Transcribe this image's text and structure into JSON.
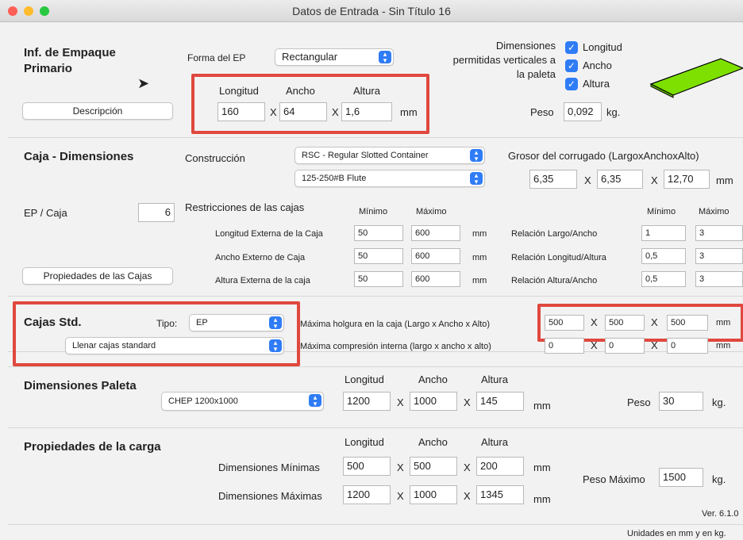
{
  "window": {
    "title": "Datos de Entrada - Sin Título 16"
  },
  "icons": {
    "close": "#fe5f57",
    "minimize": "#febc2e",
    "zoom": "#28c840",
    "accent": "#2f7cf6",
    "highlight": "#e0483e",
    "package": "#7ee000"
  },
  "s1": {
    "title_l1": "Inf. de Empaque",
    "title_l2": "Primario",
    "forma_label": "Forma del EP",
    "forma_value": "Rectangular",
    "descripcion": "Descripción",
    "hdr_longitud": "Longitud",
    "hdr_ancho": "Ancho",
    "hdr_altura": "Altura",
    "longitud": "160",
    "ancho": "64",
    "altura": "1,6",
    "x": "X",
    "mm": "mm",
    "dim_l1": "Dimensiones",
    "dim_l2": "permitidas verticales a",
    "dim_l3": "la paleta",
    "chk_longitud": "Longitud",
    "chk_ancho": "Ancho",
    "chk_altura": "Altura",
    "peso_label": "Peso",
    "peso": "0,092",
    "kg": "kg."
  },
  "s2": {
    "title": "Caja - Dimensiones",
    "construccion_label": "Construcción",
    "construccion": "RSC - Regular Slotted Container",
    "flute": "125-250#B Flute",
    "grosor_label": "Grosor del corrugado (LargoxAnchoxAlto)",
    "g1": "6,35",
    "g2": "6,35",
    "g3": "12,70",
    "x": "X",
    "mm": "mm",
    "ep_caja_label": "EP / Caja",
    "ep_caja": "6",
    "restricciones": "Restricciones de las cajas",
    "minimo": "Mínimo",
    "maximo": "Máximo",
    "rows": [
      {
        "label": "Longitud Externa de la Caja",
        "min": "50",
        "max": "600",
        "unit": "mm",
        "rlabel": "Relación Largo/Ancho",
        "rmin": "1",
        "rmax": "3"
      },
      {
        "label": "Ancho Externo de Caja",
        "min": "50",
        "max": "600",
        "unit": "mm",
        "rlabel": "Relación Longitud/Altura",
        "rmin": "0,5",
        "rmax": "3"
      },
      {
        "label": "Altura Externa de la caja",
        "min": "50",
        "max": "600",
        "unit": "mm",
        "rlabel": "Relación Altura/Ancho",
        "rmin": "0,5",
        "rmax": "3"
      }
    ],
    "propiedades": "Propiedades de las Cajas"
  },
  "s3": {
    "title": "Cajas Std.",
    "tipo_label": "Tipo:",
    "tipo": "EP",
    "llenar": "Llenar cajas standard",
    "holgura_label": "Máxima holgura en la caja (Largo x Ancho x Alto)",
    "h1": "500",
    "h2": "500",
    "h3": "500",
    "compresion_label": "Máxima compresión interna (largo x ancho x alto)",
    "c1": "0",
    "c2": "0",
    "c3": "0",
    "x": "X",
    "mm": "mm"
  },
  "s4": {
    "title": "Dimensiones Paleta",
    "paleta": "CHEP 1200x1000",
    "hdr_longitud": "Longitud",
    "hdr_ancho": "Ancho",
    "hdr_altura": "Altura",
    "longitud": "1200",
    "ancho": "1000",
    "altura": "145",
    "x": "X",
    "mm": "mm",
    "peso_label": "Peso",
    "peso": "30",
    "kg": "kg."
  },
  "s5": {
    "title": "Propiedades de la carga",
    "hdr_longitud": "Longitud",
    "hdr_ancho": "Ancho",
    "hdr_altura": "Altura",
    "min_label": "Dimensiones Mínimas",
    "min_l": "500",
    "min_a": "500",
    "min_h": "200",
    "max_label": "Dimensiones Máximas",
    "max_l": "1200",
    "max_a": "1000",
    "max_h": "1345",
    "x": "X",
    "mm": "mm",
    "peso_label": "Peso Máximo",
    "peso": "1500",
    "kg": "kg.",
    "version": "Ver. 6.1.0"
  },
  "footer": {
    "units": "Unidades en mm y en kg."
  }
}
